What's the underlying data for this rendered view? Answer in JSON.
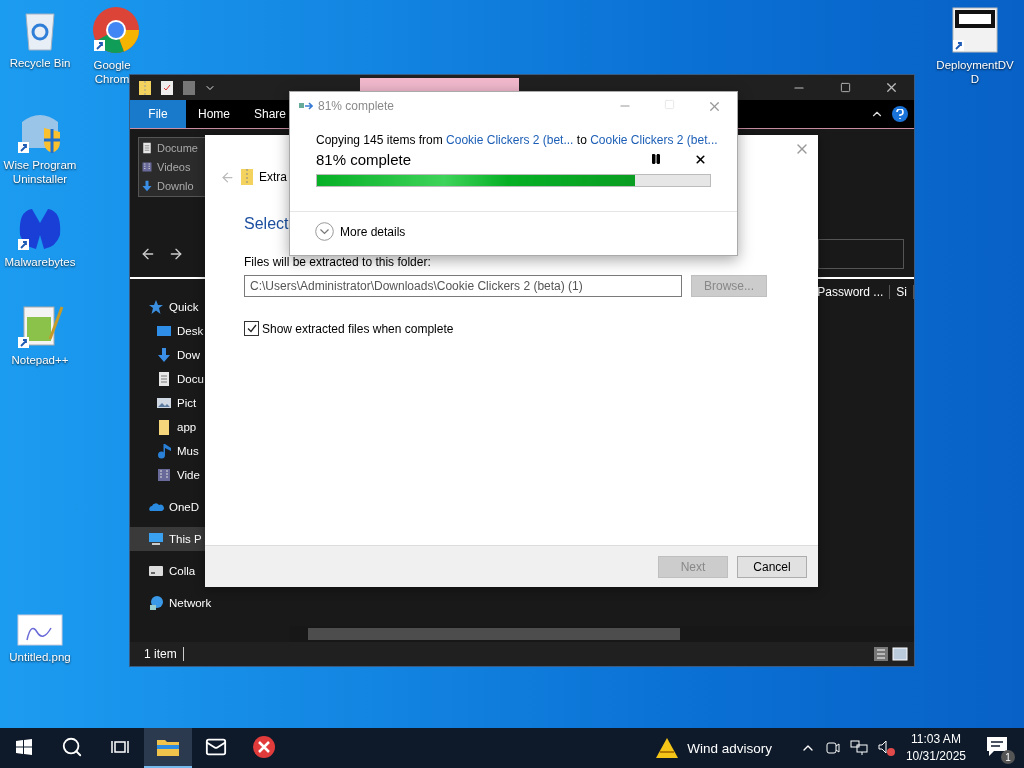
{
  "desktop_icons": [
    {
      "label": "Recycle Bin",
      "kind": "recycle"
    },
    {
      "label": "Google Chrom",
      "kind": "chrome"
    },
    {
      "label": "Wise Program Uninstaller",
      "kind": "wise"
    },
    {
      "label": "Malwarebytes",
      "kind": "malware"
    },
    {
      "label": "Notepad++",
      "kind": "notepad"
    },
    {
      "label": "Untitled.png",
      "kind": "image"
    },
    {
      "label": "DeploymentDVD",
      "kind": "dvd"
    }
  ],
  "explorer": {
    "ribbon_tabs": [
      {
        "label": "File",
        "selected": true
      },
      {
        "label": "Home",
        "selected": false
      },
      {
        "label": "Share",
        "selected": false
      }
    ],
    "recent_list": [
      {
        "label": "Docume",
        "kind": "document"
      },
      {
        "label": "Videos",
        "kind": "video"
      },
      {
        "label": "Downlo",
        "kind": "download"
      }
    ],
    "nav_items": [
      {
        "label": "Quick",
        "kind": "star",
        "selected": false,
        "children": [
          {
            "label": "Desk",
            "kind": "desktop",
            "selected": false
          },
          {
            "label": "Dow",
            "kind": "download",
            "selected": false
          },
          {
            "label": "Docu",
            "kind": "document",
            "selected": false
          },
          {
            "label": "Pict",
            "kind": "picture",
            "selected": false
          },
          {
            "label": "app",
            "kind": "folder",
            "selected": false
          },
          {
            "label": "Mus",
            "kind": "music",
            "selected": false
          },
          {
            "label": "Vide",
            "kind": "video",
            "selected": false
          }
        ]
      },
      {
        "label": "OneD",
        "kind": "cloud",
        "selected": false
      },
      {
        "label": "This P",
        "kind": "pc",
        "selected": true
      },
      {
        "label": "Colla",
        "kind": "drive",
        "selected": false
      },
      {
        "label": "Network",
        "kind": "network",
        "selected": false
      }
    ],
    "columns": [
      "Password ...",
      "Si"
    ],
    "status": "1 item"
  },
  "extract_wizard": {
    "title": "Extra",
    "heading": "Select",
    "folder_label": "Files will be extracted to this folder:",
    "path": "C:\\Users\\Administrator\\Downloads\\Cookie Clickers 2 (beta) (1)",
    "browse": {
      "label": "Browse...",
      "disabled": true
    },
    "show_files": {
      "label": "Show extracted files when complete",
      "checked": true
    },
    "buttons": [
      {
        "label": "Next",
        "disabled": true
      },
      {
        "label": "Cancel",
        "disabled": false
      }
    ]
  },
  "progress_dialog": {
    "title": "81% complete",
    "message": {
      "prefix": "Copying 145 items from",
      "source": "Cookie Clickers 2 (bet...",
      "joiner": "to",
      "destination": "Cookie Clickers 2 (bet..."
    },
    "status": "81% complete",
    "level": 0.81,
    "more_details": "More details"
  },
  "taskbar": {
    "apps": [
      {
        "kind": "start",
        "selected": false
      },
      {
        "kind": "search",
        "selected": false
      },
      {
        "kind": "taskview",
        "selected": false
      },
      {
        "kind": "explorer",
        "selected": true
      },
      {
        "kind": "mail",
        "selected": false
      },
      {
        "kind": "redapp",
        "selected": false
      }
    ],
    "weather": "Wind advisory",
    "time": "11:03 AM",
    "date": "10/31/2025",
    "notifications": "1"
  }
}
